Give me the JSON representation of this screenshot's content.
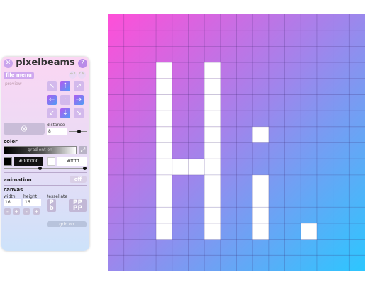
{
  "app": {
    "title": "pixelbeams"
  },
  "header": {
    "close_glyph": "✕",
    "help_glyph": "?"
  },
  "toolbar": {
    "file_menu_label": "file menu",
    "undo_glyph": "↶",
    "redo_glyph": "↷"
  },
  "preview": {
    "label": "preview"
  },
  "direction_pad": {
    "arrows": [
      "↖",
      "↑",
      "↗",
      "←",
      "·",
      "→",
      "↙",
      "↓",
      "↘"
    ],
    "highlighted": [
      1,
      3,
      5,
      7
    ]
  },
  "distance": {
    "label": "distance",
    "value": "8",
    "slider_fraction": 0.55
  },
  "color": {
    "section_label": "color",
    "gradient_label": "gradient on",
    "color1_hex": "#000000",
    "color2_hex": "#ffffff",
    "swatch_dark": "#000000",
    "swatch_light": "#ffffff"
  },
  "animation": {
    "section_label": "animation",
    "toggle_label": "off"
  },
  "canvas_settings": {
    "section_label": "canvas",
    "width_label": "width",
    "width_value": "16",
    "height_label": "height",
    "height_value": "16",
    "tessellate_label": "tessellate",
    "tess_glyphs": [
      "P\nb",
      "PP\nPP"
    ],
    "stepper_glyphs": [
      "-",
      "+",
      "-",
      "+"
    ],
    "grid_label": "grid on"
  },
  "grid": {
    "cols": 16,
    "rows": 16,
    "filled_cells": [
      [
        3,
        3
      ],
      [
        6,
        3
      ],
      [
        3,
        4
      ],
      [
        6,
        4
      ],
      [
        3,
        5
      ],
      [
        6,
        5
      ],
      [
        3,
        6
      ],
      [
        6,
        6
      ],
      [
        3,
        7
      ],
      [
        6,
        7
      ],
      [
        9,
        7
      ],
      [
        3,
        8
      ],
      [
        6,
        8
      ],
      [
        3,
        9
      ],
      [
        4,
        9
      ],
      [
        5,
        9
      ],
      [
        6,
        9
      ],
      [
        3,
        10
      ],
      [
        6,
        10
      ],
      [
        9,
        10
      ],
      [
        3,
        11
      ],
      [
        6,
        11
      ],
      [
        9,
        11
      ],
      [
        3,
        12
      ],
      [
        6,
        12
      ],
      [
        9,
        12
      ],
      [
        3,
        13
      ],
      [
        6,
        13
      ],
      [
        9,
        13
      ],
      [
        12,
        13
      ]
    ]
  }
}
